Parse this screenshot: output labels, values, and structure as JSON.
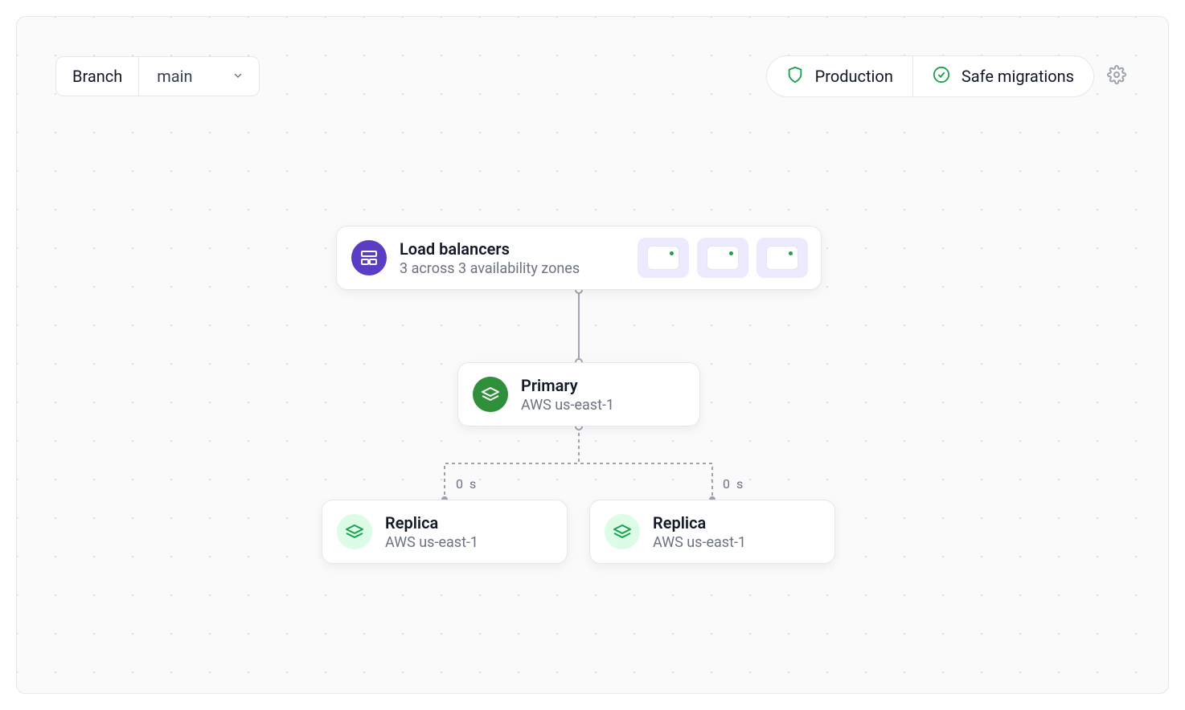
{
  "toolbar": {
    "branch_label": "Branch",
    "branch_value": "main",
    "production_label": "Production",
    "safe_migrations_label": "Safe migrations"
  },
  "load_balancers": {
    "title": "Load balancers",
    "subtitle": "3 across 3 availability zones",
    "count": 3
  },
  "primary": {
    "title": "Primary",
    "region": "AWS us-east-1"
  },
  "replicas": [
    {
      "title": "Replica",
      "region": "AWS us-east-1",
      "lag_value": "0",
      "lag_unit": "s"
    },
    {
      "title": "Replica",
      "region": "AWS us-east-1",
      "lag_value": "0",
      "lag_unit": "s"
    }
  ]
}
